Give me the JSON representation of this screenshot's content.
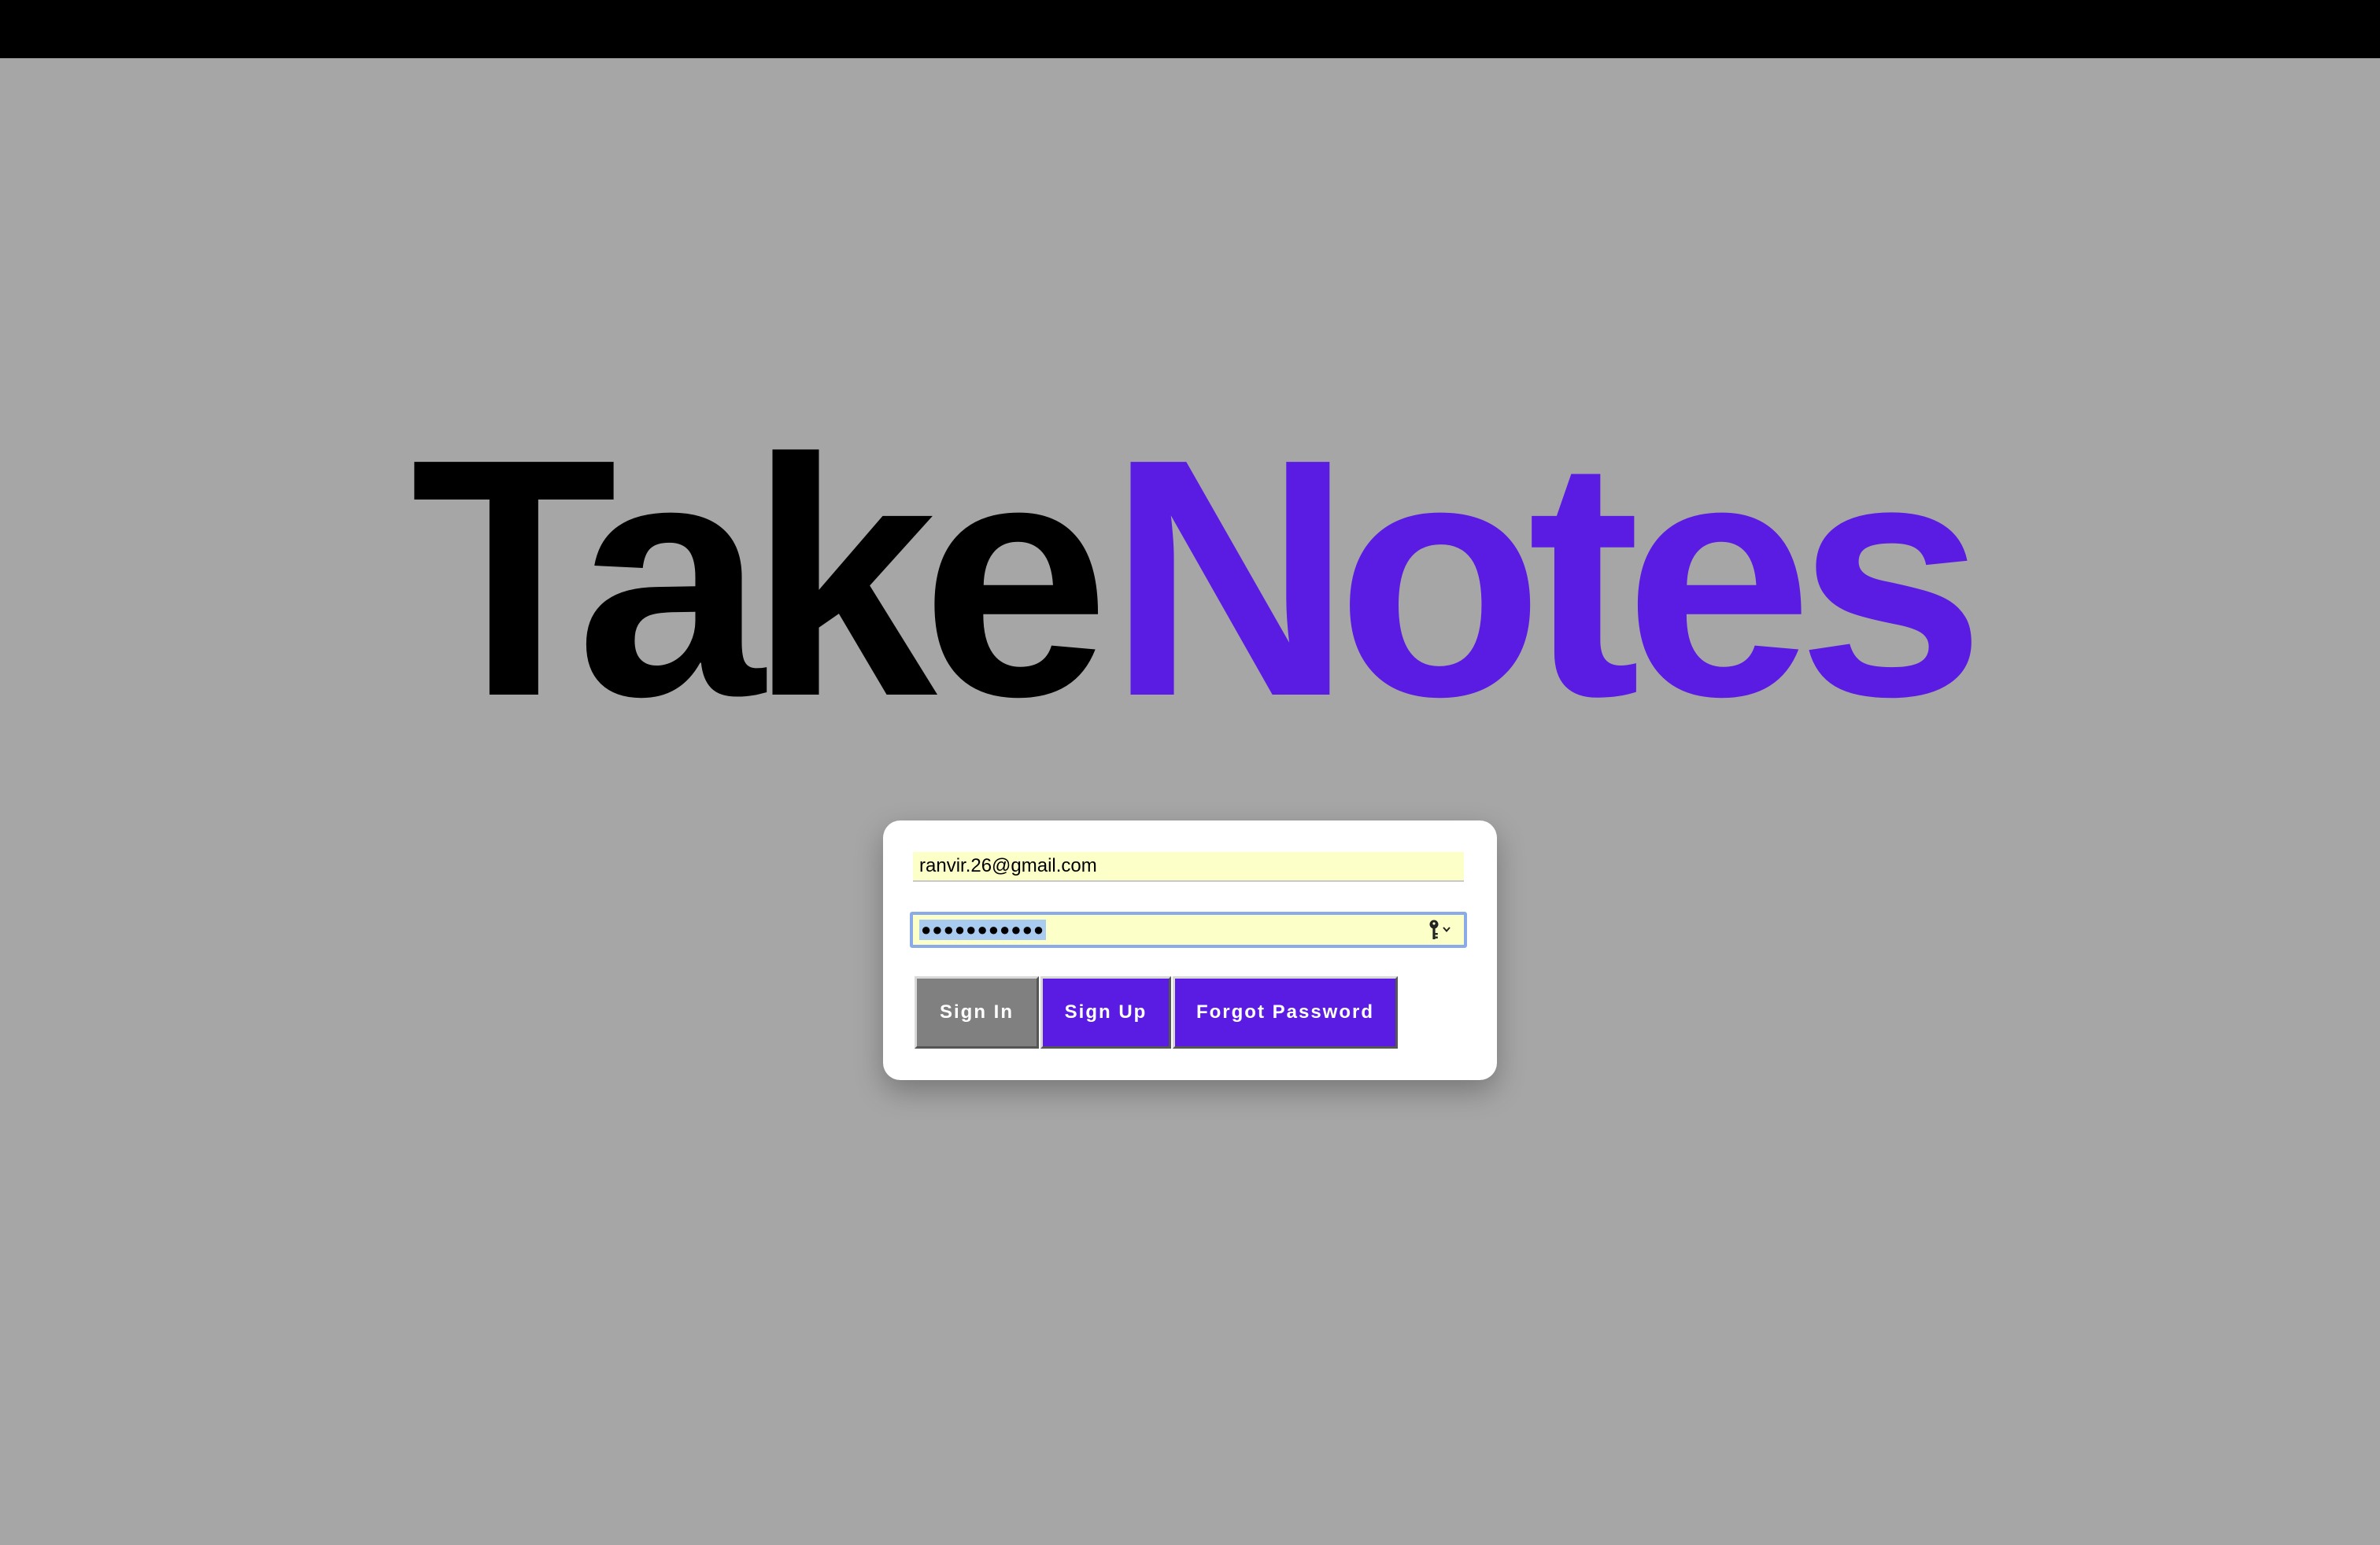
{
  "logo": {
    "part1": "Take",
    "part2": "Notes"
  },
  "login": {
    "email_value": "ranvir.26@gmail.com",
    "password_masked": "●●●●●●●●●●●",
    "buttons": {
      "sign_in": "Sign In",
      "sign_up": "Sign Up",
      "forgot_password": "Forgot Password"
    }
  },
  "colors": {
    "brand_purple": "#5a1be3",
    "background": "#a6a6a6",
    "autofill": "#fcffc8",
    "disabled_button": "#808080"
  },
  "icons": {
    "password_manager": "key-icon"
  }
}
